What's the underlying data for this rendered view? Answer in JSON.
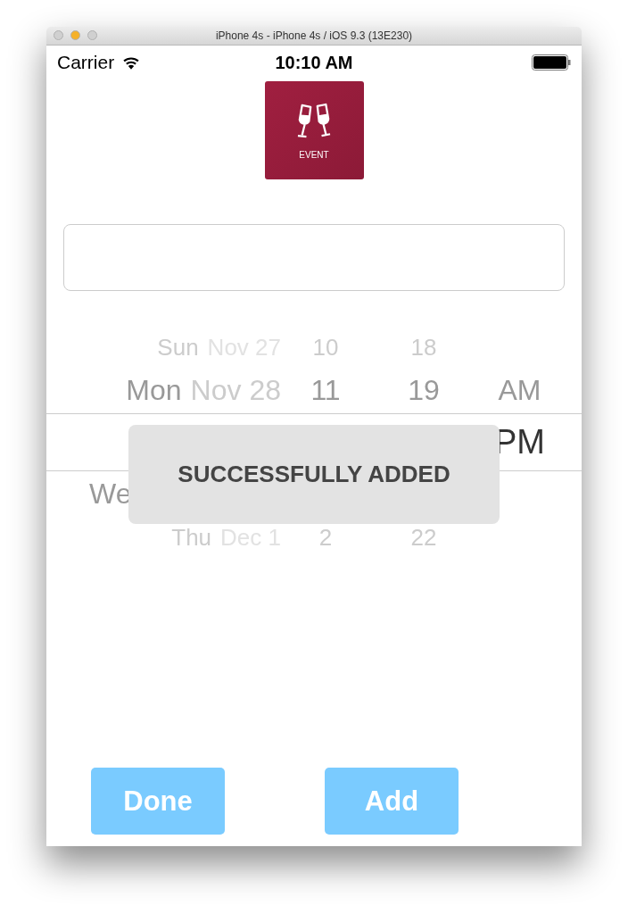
{
  "window": {
    "title": "iPhone 4s - iPhone 4s / iOS 9.3 (13E230)",
    "lights": [
      {
        "color": "#d0d0d0"
      },
      {
        "color": "#f5b12a"
      },
      {
        "color": "#d0d0d0"
      }
    ]
  },
  "status_bar": {
    "carrier": "Carrier",
    "time": "10:10 AM"
  },
  "event_tile": {
    "label": "EVENT"
  },
  "picker": {
    "rows": [
      {
        "day": "Sun",
        "date": "Nov 27",
        "hour": "10",
        "minute": "18",
        "selected": false
      },
      {
        "day": "Mon",
        "date": "Nov 28",
        "hour": "11",
        "minute": "19",
        "period": "AM",
        "selected": false
      },
      {
        "period": "PM",
        "selected": true
      },
      {
        "day": "We",
        "selected": false
      },
      {
        "day": "Thu",
        "date": "Dec 1",
        "hour": "2",
        "minute": "22",
        "selected": false
      }
    ]
  },
  "toast": {
    "text": "SUCCESSFULLY ADDED"
  },
  "buttons": [
    {
      "label": "Done"
    },
    {
      "label": "Add"
    }
  ]
}
